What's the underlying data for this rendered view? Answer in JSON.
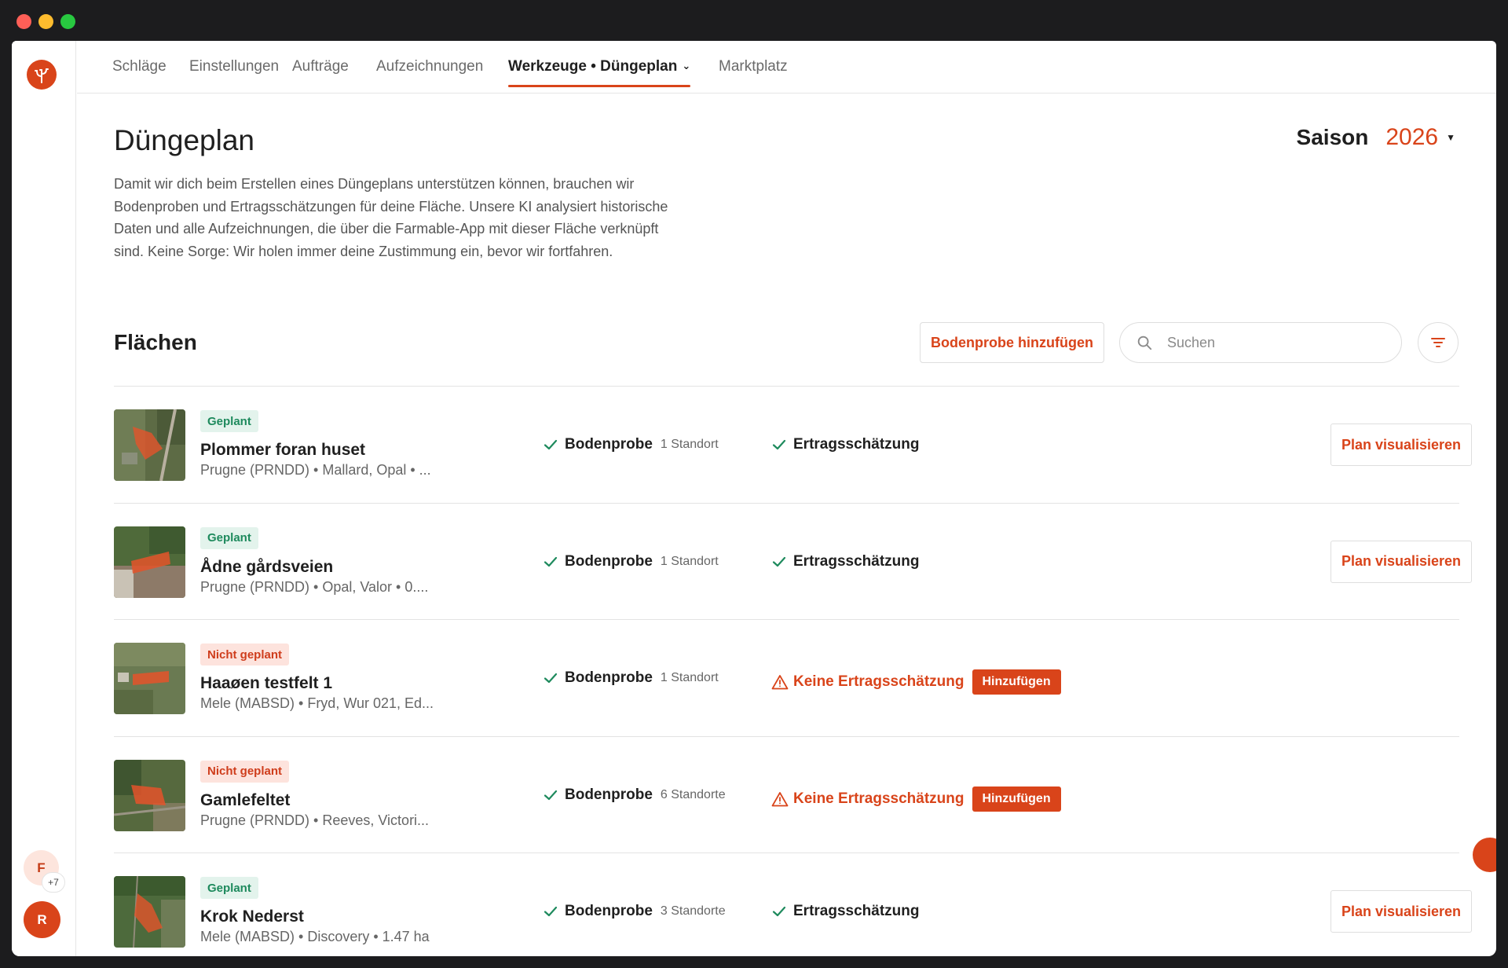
{
  "nav": {
    "tabs": [
      {
        "label": "Schläge"
      },
      {
        "label": "Einstellungen"
      },
      {
        "label": "Aufträge"
      },
      {
        "label": "Aufzeichnungen"
      },
      {
        "label": "Werkzeuge • Düngeplan"
      },
      {
        "label": "Marktplatz"
      }
    ],
    "active_tab": "Werkzeuge • Düngeplan"
  },
  "sidebar": {
    "avatar_f": "F",
    "avatar_more": "+7",
    "avatar_r": "R"
  },
  "page": {
    "title": "Düngeplan",
    "description": "Damit wir dich beim Erstellen eines Düngeplans unterstützen können, brauchen wir Bodenproben und Ertragsschätzungen für deine Fläche. Unsere KI analysiert historische Daten und alle Aufzeichnungen, die über die Farmable-App mit dieser Fläche verknüpft sind. Keine Sorge: Wir holen immer deine Zustimmung ein, bevor wir fortfahren.",
    "season_label": "Saison",
    "season_year": "2026"
  },
  "fields_section": {
    "title": "Flächen",
    "add_soil_sample_label": "Bodenprobe hinzufügen",
    "search_placeholder": "Suchen",
    "rows": [
      {
        "status": "Geplant",
        "name": "Plommer foran huset",
        "subtitle": "Prugne (PRNDD) • Mallard, Opal • ...",
        "soil_label": "Bodenprobe",
        "soil_count": "1 Standort",
        "yield_label": "Ertragsschätzung",
        "plan_button": "Plan visualisieren"
      },
      {
        "status": "Geplant",
        "name": "Ådne gårdsveien",
        "subtitle": "Prugne (PRNDD) • Opal, Valor • 0....",
        "soil_label": "Bodenprobe",
        "soil_count": "1 Standort",
        "yield_label": "Ertragsschätzung",
        "plan_button": "Plan visualisieren"
      },
      {
        "status": "Nicht geplant",
        "name": "Haaøen testfelt 1",
        "subtitle": "Mele (MABSD) • Fryd, Wur 021, Ed...",
        "soil_label": "Bodenprobe",
        "soil_count": "1 Standort",
        "yield_label": "Keine Ertragsschätzung",
        "add_button": "Hinzufügen"
      },
      {
        "status": "Nicht geplant",
        "name": "Gamlefeltet",
        "subtitle": "Prugne (PRNDD) • Reeves, Victori...",
        "soil_label": "Bodenprobe",
        "soil_count": "6 Standorte",
        "yield_label": "Keine Ertragsschätzung",
        "add_button": "Hinzufügen"
      },
      {
        "status": "Geplant",
        "name": "Krok Nederst",
        "subtitle": "Mele (MABSD) • Discovery • 1.47 ha",
        "soil_label": "Bodenprobe",
        "soil_count": "3 Standorte",
        "yield_label": "Ertragsschätzung",
        "plan_button": "Plan visualisieren"
      }
    ]
  },
  "colors": {
    "accent": "#d9441a",
    "planned_badge_text": "#1e8a5d",
    "planned_badge_bg": "#e3f3ec",
    "unplanned_badge_bg": "#fde3dd",
    "check": "#1e8a5d"
  }
}
